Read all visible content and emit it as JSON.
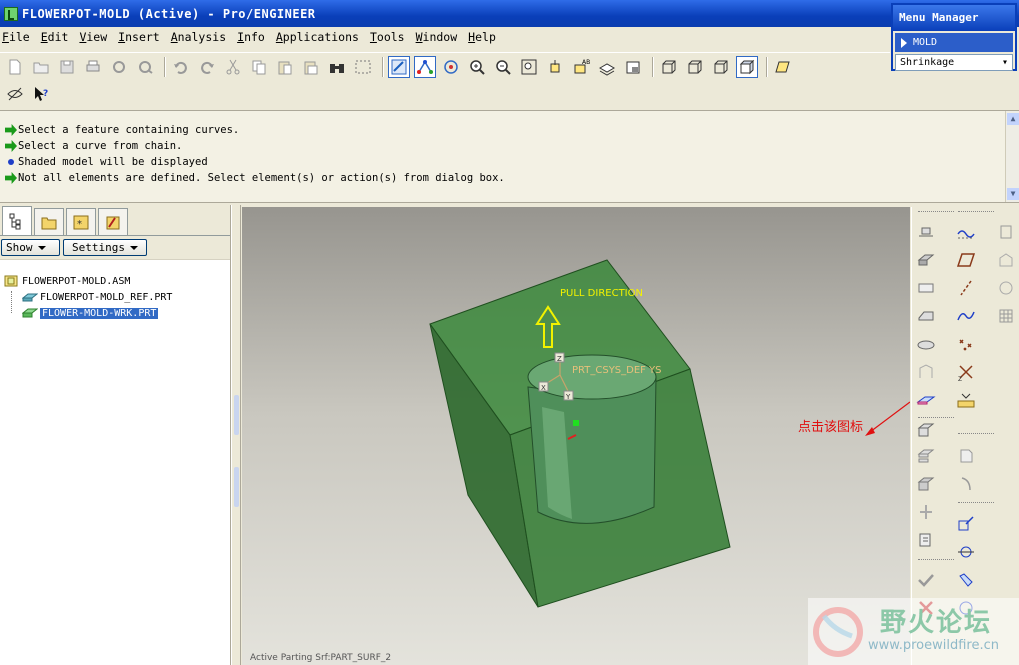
{
  "window": {
    "title": "FLOWERPOT-MOLD (Active) - Pro/ENGINEER"
  },
  "menubar": {
    "items": [
      "File",
      "Edit",
      "View",
      "Insert",
      "Analysis",
      "Info",
      "Applications",
      "Tools",
      "Window",
      "Help"
    ]
  },
  "menu_manager": {
    "title": "Menu Manager",
    "selected_item": "MOLD",
    "dropdown_value": "Shrinkage"
  },
  "messages": [
    {
      "icon": "green-arrow-icon",
      "text": "Select a feature containing curves."
    },
    {
      "icon": "green-arrow-icon",
      "text": "Select a curve from chain."
    },
    {
      "icon": "blue-dot-icon",
      "text": "Shaded model will be displayed"
    },
    {
      "icon": "green-arrow-icon",
      "text": "Not all elements are defined. Select element(s) or action(s) from dialog box."
    }
  ],
  "model_tree": {
    "show_label": "Show",
    "settings_label": "Settings",
    "root": "FLOWERPOT-MOLD.ASM",
    "children": [
      {
        "label": "FLOWERPOT-MOLD_REF.PRT",
        "selected": false
      },
      {
        "label": "FLOWER-MOLD-WRK.PRT",
        "selected": true
      }
    ]
  },
  "viewport": {
    "labels": {
      "pull_direction": "PULL DIRECTION",
      "csys": "PRT_CSYS_DEF",
      "csys_suffix": "YS",
      "axis_z": "Z",
      "axis_x": "X",
      "axis_y": "Y"
    },
    "status": "Active Parting Srf:PART_SURF_2",
    "colors": {
      "block": "#3a7f3a",
      "pull_arrow": "#f2f200",
      "label": "#e6c07a"
    }
  },
  "annotation": {
    "text": "点击该图标",
    "color": "#e01010"
  },
  "watermark": {
    "title": "野火论坛",
    "url": "www.proewildfire.cn"
  }
}
